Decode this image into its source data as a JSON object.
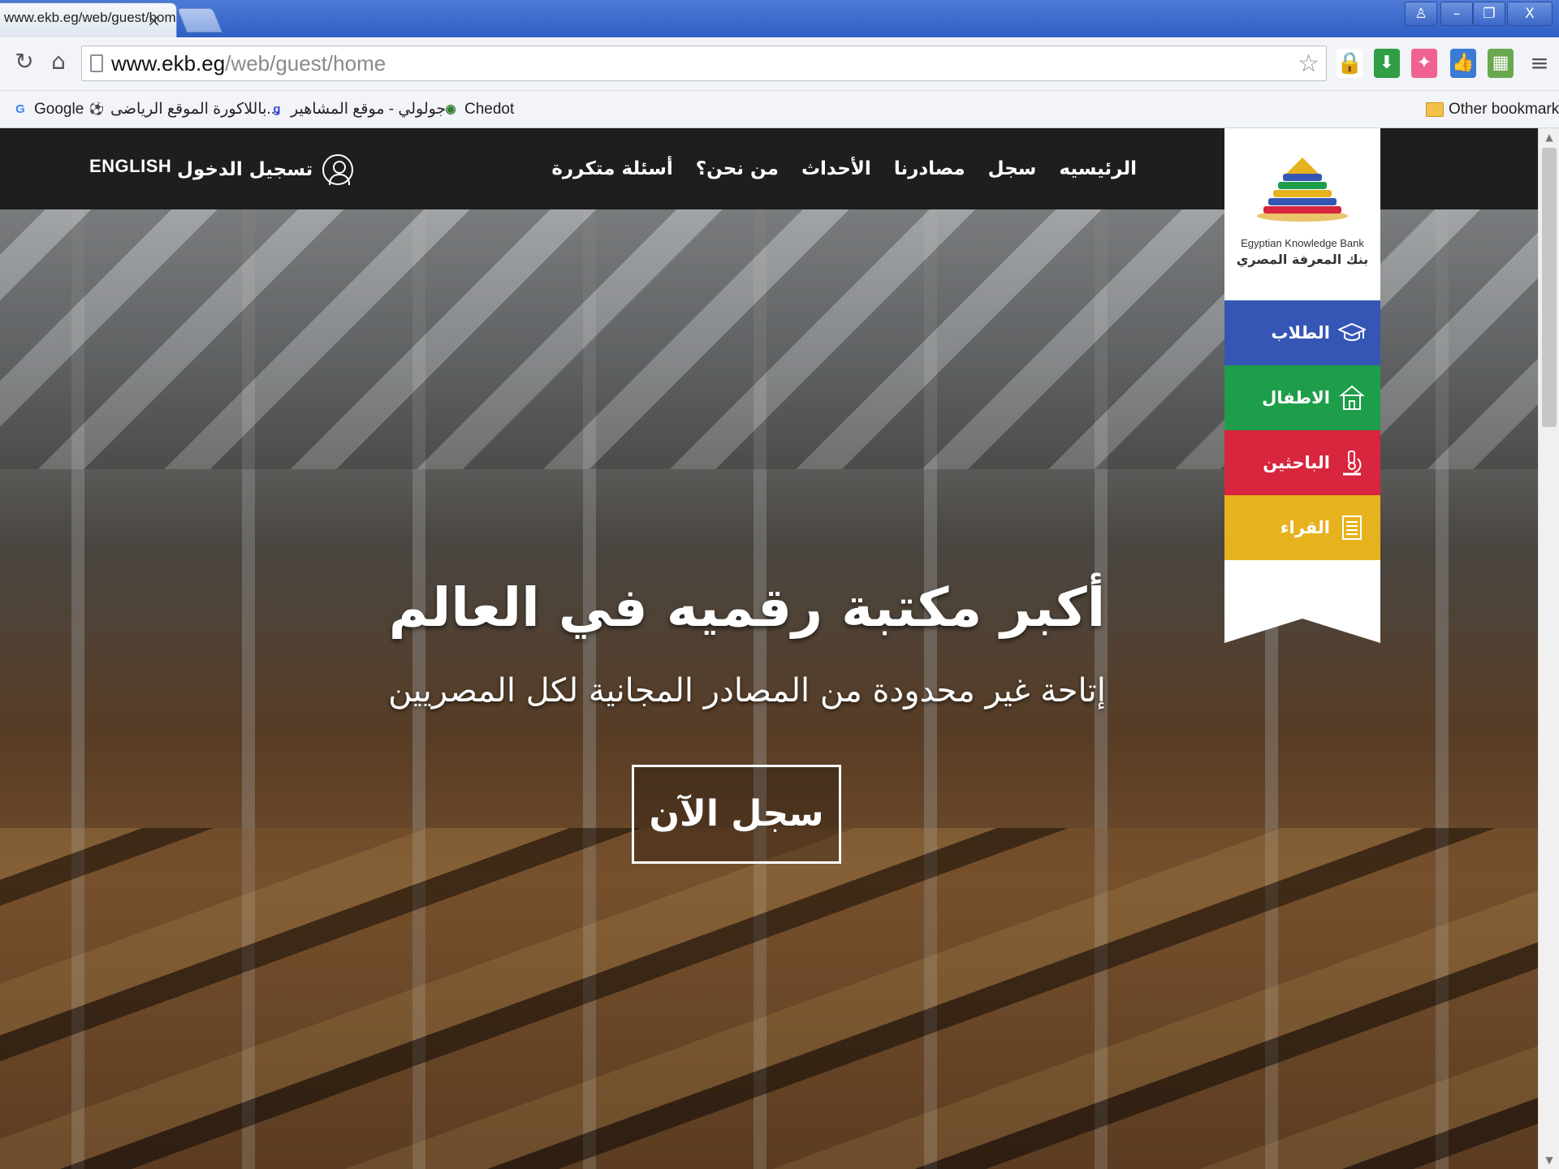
{
  "browser": {
    "tab_title": "www.ekb.eg/web/guest/home",
    "tab_close": "×",
    "url_host": "www.ekb.eg",
    "url_path": "/web/guest/home",
    "window_controls": [
      "♙",
      "–",
      "❐",
      "X"
    ],
    "bookmarks": [
      {
        "label": "Google",
        "icon": "google-icon",
        "glyph": "G",
        "color": "#4285f4"
      },
      {
        "label": "باللاكورة الموقع الرياضى...",
        "icon": "football-icon",
        "glyph": "⚽",
        "color": "#222222"
      },
      {
        "label": "جولولي - موقع المشاهير",
        "icon": "goloolive-icon",
        "glyph": "g",
        "color": "#3b4ce0"
      },
      {
        "label": "Chedot",
        "icon": "chedot-icon",
        "glyph": "◉",
        "color": "#2e7d32"
      }
    ],
    "other_bookmarks": "Other bookmarks"
  },
  "site": {
    "nav": [
      "الرئيسيه",
      "سجل",
      "مصادرنا",
      "الأحداث",
      "من نحن؟",
      "أسئلة متكررة"
    ],
    "login_label": "تسجيل الدخول",
    "language_label": "ENGLISH",
    "logo_en": "Egyptian Knowledge Bank",
    "logo_ar": "بنك المعرفة المصري",
    "side_menu": [
      {
        "label": "الطلاب",
        "icon": "graduation-cap-icon",
        "glyph": "🎓",
        "color": "#3656b5"
      },
      {
        "label": "الاطفال",
        "icon": "house-icon",
        "glyph": "⌂",
        "color": "#1e9e4a"
      },
      {
        "label": "الباحثين",
        "icon": "microscope-icon",
        "glyph": "⚗",
        "color": "#d7263d"
      },
      {
        "label": "القراء",
        "icon": "document-icon",
        "glyph": "☰",
        "color": "#e6b21e"
      }
    ],
    "hero_title": "أكبر مكتبة رقميه في العالم",
    "hero_subtitle": "إتاحة غير محدودة من المصادر المجانية لكل المصريين",
    "cta_label": "سجل الآن"
  },
  "colors": {
    "header_bg": "#1e1e1e",
    "students": "#3656b5",
    "children": "#1e9e4a",
    "researchers": "#d7263d",
    "readers": "#e6b21e"
  }
}
